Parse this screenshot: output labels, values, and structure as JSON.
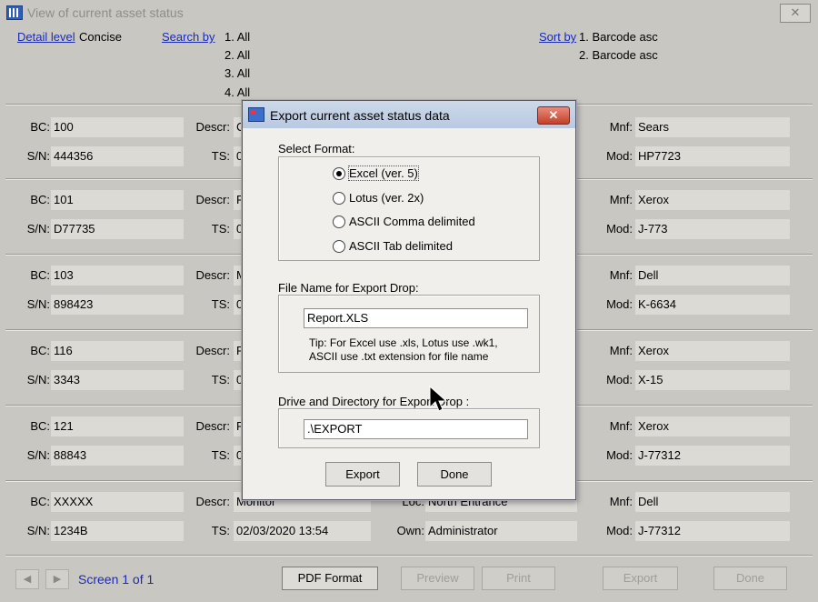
{
  "window": {
    "title": "View of current asset status",
    "close_label": "✕"
  },
  "header": {
    "detail_level_label": "Detail level",
    "detail_level_value": "Concise",
    "search_by_label": "Search by",
    "search_by": [
      "1. All",
      "2. All",
      "3. All",
      "4. All"
    ],
    "sort_by_label": "Sort by",
    "sort_by": [
      "1. Barcode asc",
      "2. Barcode asc"
    ]
  },
  "labels": {
    "bc": "BC:",
    "sn": "S/N:",
    "descr": "Descr:",
    "ts": "TS:",
    "loc": "Loc:",
    "own": "Own:",
    "mnf": "Mnf:",
    "mod": "Mod:"
  },
  "records": [
    {
      "bc": "100",
      "sn": "444356",
      "descr": "C",
      "ts": "0",
      "mnf": "Sears",
      "mod": "HP7723"
    },
    {
      "bc": "101",
      "sn": "D77735",
      "descr": "F",
      "ts": "0",
      "mnf": "Xerox",
      "mod": "J-773"
    },
    {
      "bc": "103",
      "sn": "898423",
      "descr": "M",
      "ts": "0",
      "mnf": "Dell",
      "mod": "K-6634"
    },
    {
      "bc": "116",
      "sn": "3343",
      "descr": "F",
      "ts": "0",
      "mnf": "Xerox",
      "mod": "X-15"
    },
    {
      "bc": "121",
      "sn": "88843",
      "descr": "F",
      "ts": "0",
      "mnf": "Xerox",
      "mod": "J-77312"
    },
    {
      "bc": "XXXXX",
      "sn": "1234B",
      "descr": "Monitor",
      "ts": "02/03/2020 13:54",
      "loc": "North Entrance",
      "own": "Administrator",
      "mnf": "Dell",
      "mod": "J-77312"
    }
  ],
  "footer": {
    "prev_icon": "◀",
    "next_icon": "▶",
    "screen_text": "Screen 1 of 1",
    "pdf_format": "PDF Format",
    "preview": "Preview",
    "print": "Print",
    "export": "Export",
    "done": "Done"
  },
  "dialog": {
    "title": "Export current asset status data",
    "close_label": "✕",
    "select_format_label": "Select Format:",
    "formats": [
      {
        "label": "Excel (ver. 5)",
        "selected": true
      },
      {
        "label": "Lotus (ver. 2x)",
        "selected": false
      },
      {
        "label": "ASCII Comma delimited",
        "selected": false
      },
      {
        "label": "ASCII Tab delimited",
        "selected": false
      }
    ],
    "file_name_label": "File Name for Export Drop:",
    "file_name_value": "Report.XLS",
    "tip_line1": "Tip: For Excel use .xls, Lotus use .wk1,",
    "tip_line2": "ASCII use .txt extension for file name",
    "drive_label": "Drive and Directory for Export Drop :",
    "drive_value": ".\\EXPORT",
    "export_button": "Export",
    "done_button": "Done"
  },
  "colors": {
    "window_bg": "#c9c7c1",
    "link": "#1a2bb5",
    "dialog_bg": "#f0efec",
    "close_red": "#c2412c"
  }
}
